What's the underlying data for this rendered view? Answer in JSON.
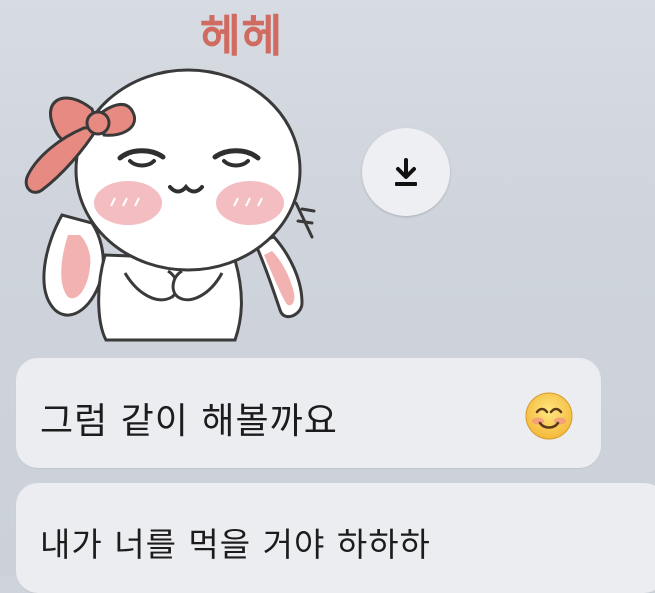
{
  "sticker": {
    "caption": "헤헤",
    "icon": "bunny-sticker"
  },
  "download": {
    "icon": "download-icon"
  },
  "messages": [
    {
      "text": "그럼 같이 해볼까요",
      "emoji": "smiling-face-with-smiling-eyes"
    },
    {
      "text": "내가 너를 먹을 거야 하하하"
    }
  ],
  "colors": {
    "caption": "#d06b61",
    "bubble": "#ecedf0",
    "background": "#cfd4dc"
  }
}
